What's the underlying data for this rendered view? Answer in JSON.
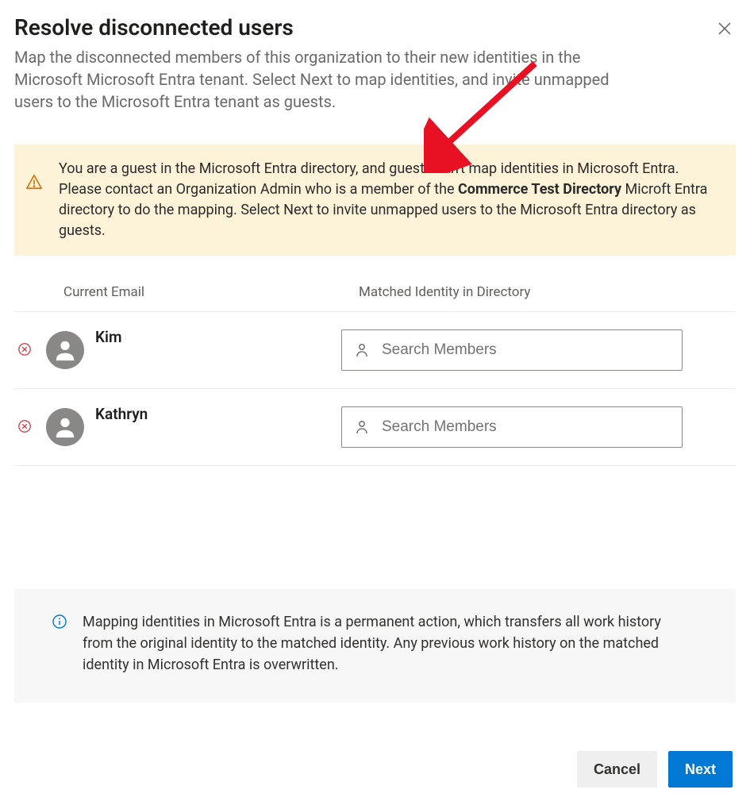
{
  "header": {
    "title": "Resolve disconnected users",
    "subtitle": "Map the disconnected members of this organization to their new identities in the Microsoft Microsoft Entra tenant. Select Next to map identities, and invite unmapped users to the Microsoft Entra tenant as guests."
  },
  "warning": {
    "pre": "You are a guest in the Microsoft Entra directory, and guests can't map identities in Microsoft Entra. Please contact an Organization Admin who is a member of the ",
    "bold": "Commerce Test Directory",
    "post": " Microft Entra directory to do the mapping. Select Next to invite unmapped users to the Microsoft Entra directory as guests."
  },
  "columns": {
    "email": "Current Email",
    "matched": "Matched Identity in Directory"
  },
  "users": [
    {
      "name": "Kim",
      "placeholder": "Search Members"
    },
    {
      "name": "Kathryn",
      "placeholder": "Search Members"
    }
  ],
  "info": {
    "text": "Mapping identities in Microsoft Entra is a permanent action, which transfers all work history from the original identity to the matched identity. Any previous work history on the matched identity in Microsoft Entra is overwritten."
  },
  "footer": {
    "cancel": "Cancel",
    "next": "Next"
  }
}
